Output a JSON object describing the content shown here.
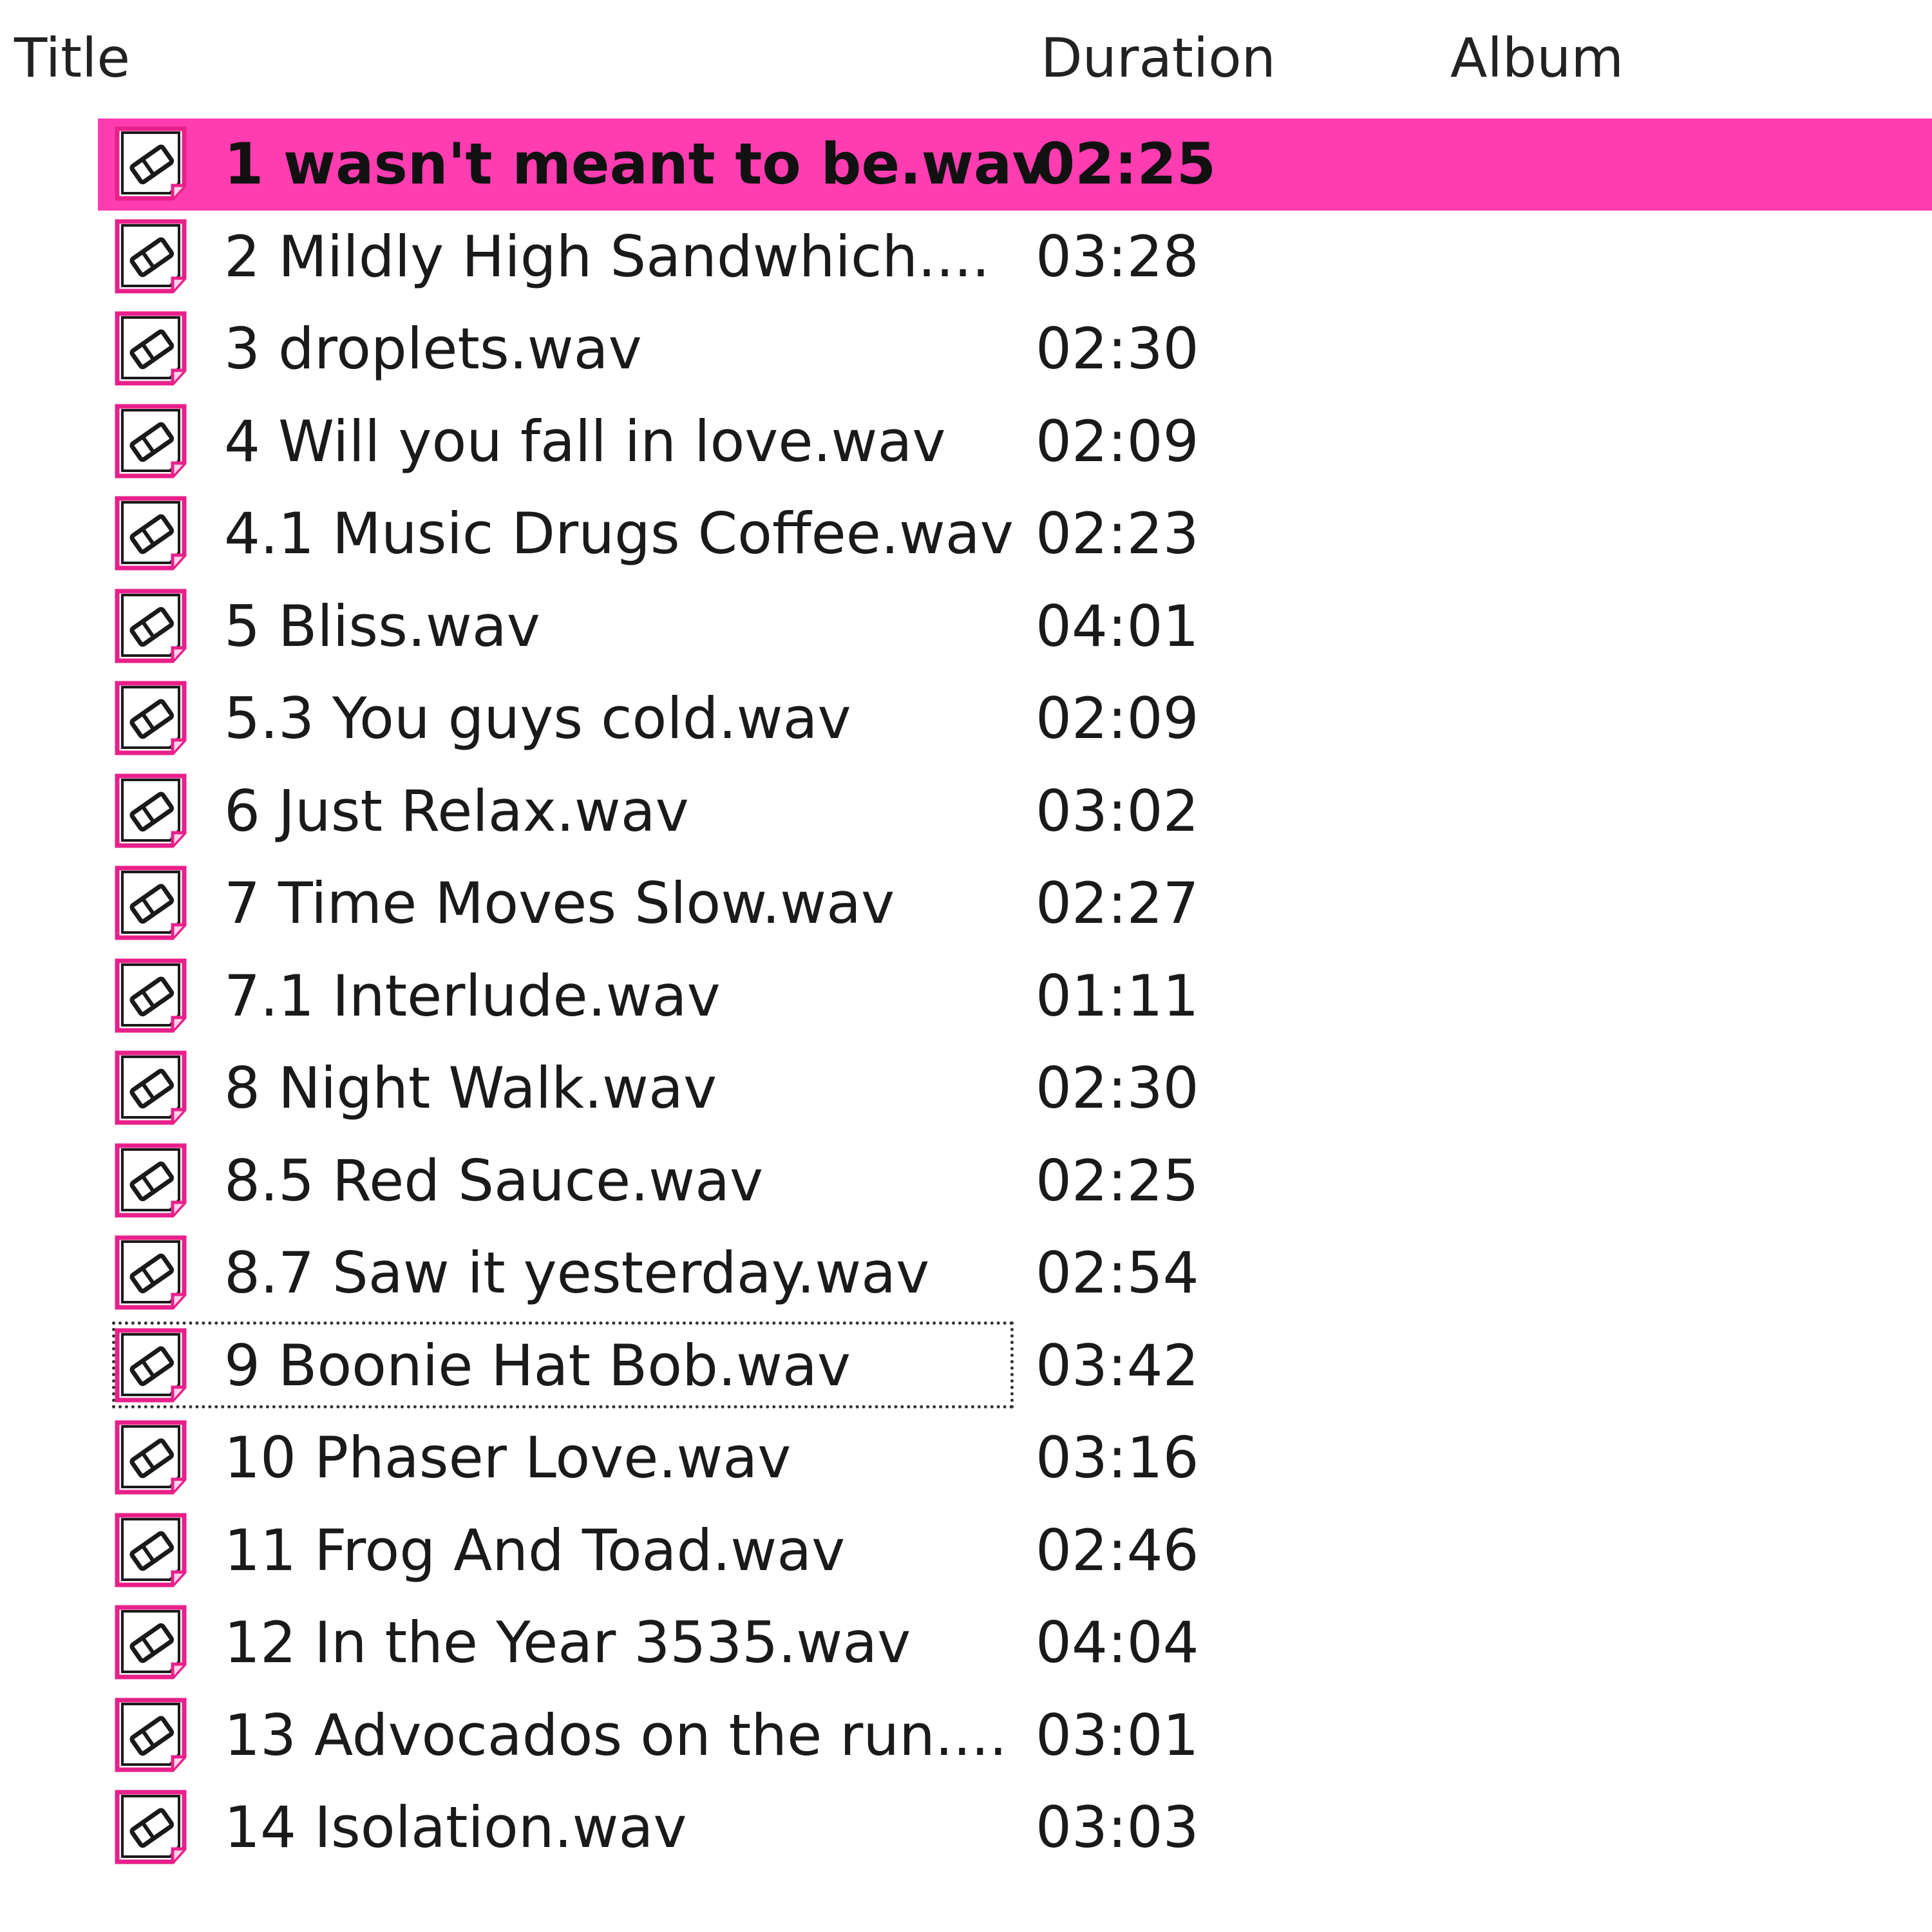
{
  "columns": {
    "title": "Title",
    "duration": "Duration",
    "album": "Album"
  },
  "colors": {
    "selection": "#ff3db0",
    "icon_accent": "#e8208a"
  },
  "icon": "audio-file-icon",
  "tracks": [
    {
      "title": "1 wasn't meant to be.wav",
      "duration": "02:25",
      "selected": true
    },
    {
      "title": "2 Mildly High Sandwhich....",
      "duration": "03:28"
    },
    {
      "title": "3 droplets.wav",
      "duration": "02:30"
    },
    {
      "title": "4 Will you fall in love.wav",
      "duration": "02:09"
    },
    {
      "title": "4.1 Music Drugs Coffee.wav",
      "duration": "02:23"
    },
    {
      "title": "5 Bliss.wav",
      "duration": "04:01"
    },
    {
      "title": "5.3 You guys cold.wav",
      "duration": "02:09"
    },
    {
      "title": "6 Just Relax.wav",
      "duration": "03:02"
    },
    {
      "title": "7 Time Moves Slow.wav",
      "duration": "02:27"
    },
    {
      "title": "7.1 Interlude.wav",
      "duration": "01:11"
    },
    {
      "title": "8 Night Walk.wav",
      "duration": "02:30"
    },
    {
      "title": "8.5 Red Sauce.wav",
      "duration": "02:25"
    },
    {
      "title": "8.7 Saw it yesterday.wav",
      "duration": "02:54"
    },
    {
      "title": "9 Boonie Hat Bob.wav",
      "duration": "03:42",
      "focused": true
    },
    {
      "title": "10 Phaser Love.wav",
      "duration": "03:16"
    },
    {
      "title": "11 Frog And Toad.wav",
      "duration": "02:46"
    },
    {
      "title": "12 In the Year 3535.wav",
      "duration": "04:04"
    },
    {
      "title": "13 Advocados on the run....",
      "duration": "03:01"
    },
    {
      "title": "14 Isolation.wav",
      "duration": "03:03"
    }
  ]
}
